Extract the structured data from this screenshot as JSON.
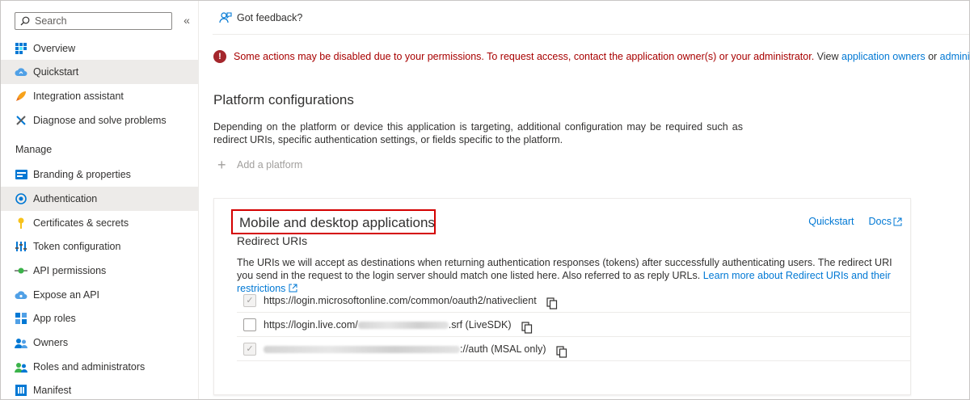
{
  "sidebar": {
    "search_placeholder": "Search",
    "collapse": "«",
    "items_top": [
      {
        "label": "Overview",
        "icon": "grid-icon"
      },
      {
        "label": "Quickstart",
        "icon": "cloud-icon"
      },
      {
        "label": "Integration assistant",
        "icon": "rocket-icon"
      },
      {
        "label": "Diagnose and solve problems",
        "icon": "wrench-icon"
      }
    ],
    "section_manage": "Manage",
    "items_manage": [
      {
        "label": "Branding & properties",
        "icon": "branding-icon"
      },
      {
        "label": "Authentication",
        "icon": "authentication-icon"
      },
      {
        "label": "Certificates & secrets",
        "icon": "key-icon"
      },
      {
        "label": "Token configuration",
        "icon": "token-bars-icon"
      },
      {
        "label": "API permissions",
        "icon": "api-permissions-icon"
      },
      {
        "label": "Expose an API",
        "icon": "cloud-api-icon"
      },
      {
        "label": "App roles",
        "icon": "app-roles-icon"
      },
      {
        "label": "Owners",
        "icon": "users-icon"
      },
      {
        "label": "Roles and administrators",
        "icon": "roles-users-icon"
      },
      {
        "label": "Manifest",
        "icon": "manifest-icon"
      }
    ],
    "selected": "Authentication"
  },
  "commandbar": {
    "feedback_label": "Got feedback?"
  },
  "warning": {
    "message": "Some actions may be disabled due to your permissions. To request access, contact the application owner(s) or your administrator.",
    "view_text": "View",
    "owners_link": "application owners",
    "or_text": "or",
    "admins_link": "administrators"
  },
  "platform": {
    "title": "Platform configurations",
    "description": "Depending on the platform or device this application is targeting, additional configuration may be required such as redirect URIs, specific authentication settings, or fields specific to the platform.",
    "add_label": "Add a platform"
  },
  "card": {
    "title": "Mobile and desktop applications",
    "quickstart_link": "Quickstart",
    "docs_link": "Docs",
    "subheading": "Redirect URIs",
    "description": "The URIs we will accept as destinations when returning authentication responses (tokens) after successfully authenticating users. The redirect URI you send in the request to the login server should match one listed here. Also referred to as reply URLs.",
    "learn_more_link": "Learn more about Redirect URIs and their restrictions",
    "uris": [
      {
        "prefix": "https://login.microsoftonline.com/common/oauth2/nativeclient",
        "suffix": "",
        "checked": true
      },
      {
        "prefix": "https://login.live.com/",
        "suffix": ".srf (LiveSDK)",
        "checked": false
      },
      {
        "prefix": "",
        "suffix": "://auth (MSAL only)",
        "checked": true
      }
    ]
  },
  "colors": {
    "accent": "#0078d4",
    "error": "#a80000",
    "highlight_box": "#d40000",
    "selected_bg": "#edebe9"
  }
}
